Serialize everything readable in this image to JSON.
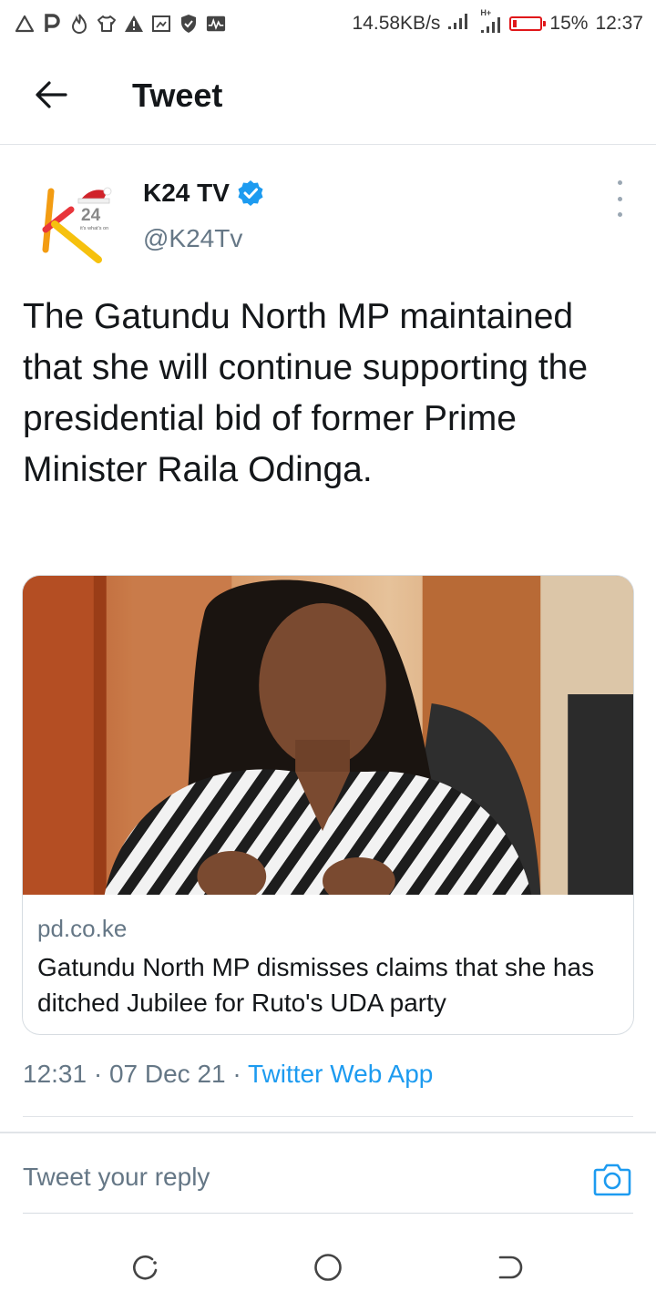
{
  "status_bar": {
    "network_speed": "14.58KB/s",
    "network_type": "H+",
    "battery_percent": "15%",
    "battery_level": 0.15,
    "time": "12:37",
    "battery_color": "#e0171a",
    "icons": [
      "alert-icon",
      "p-app-icon",
      "fire-app-icon",
      "shirt-app-icon",
      "warning-icon",
      "screenshot-icon",
      "shield-icon",
      "activity-icon"
    ]
  },
  "header": {
    "title": "Tweet"
  },
  "author": {
    "name": "K24 TV",
    "handle": "@K24Tv",
    "logo_text": "24",
    "logo_tagline": "it's what's on",
    "verified": true
  },
  "tweet": {
    "text": "The Gatundu North MP maintained that she will continue supporting the presidential bid of former Prime Minister Raila Odinga."
  },
  "link_card": {
    "domain": "pd.co.ke",
    "title": "Gatundu North MP dismisses claims that she has ditched Jubilee for Ruto's UDA party"
  },
  "meta": {
    "time": "12:31",
    "separator": "·",
    "date": "07 Dec 21",
    "app": "Twitter Web App"
  },
  "reply": {
    "placeholder": "Tweet your reply"
  },
  "colors": {
    "accent": "#1d9bf0",
    "text": "#14171a",
    "secondary": "#657786"
  }
}
